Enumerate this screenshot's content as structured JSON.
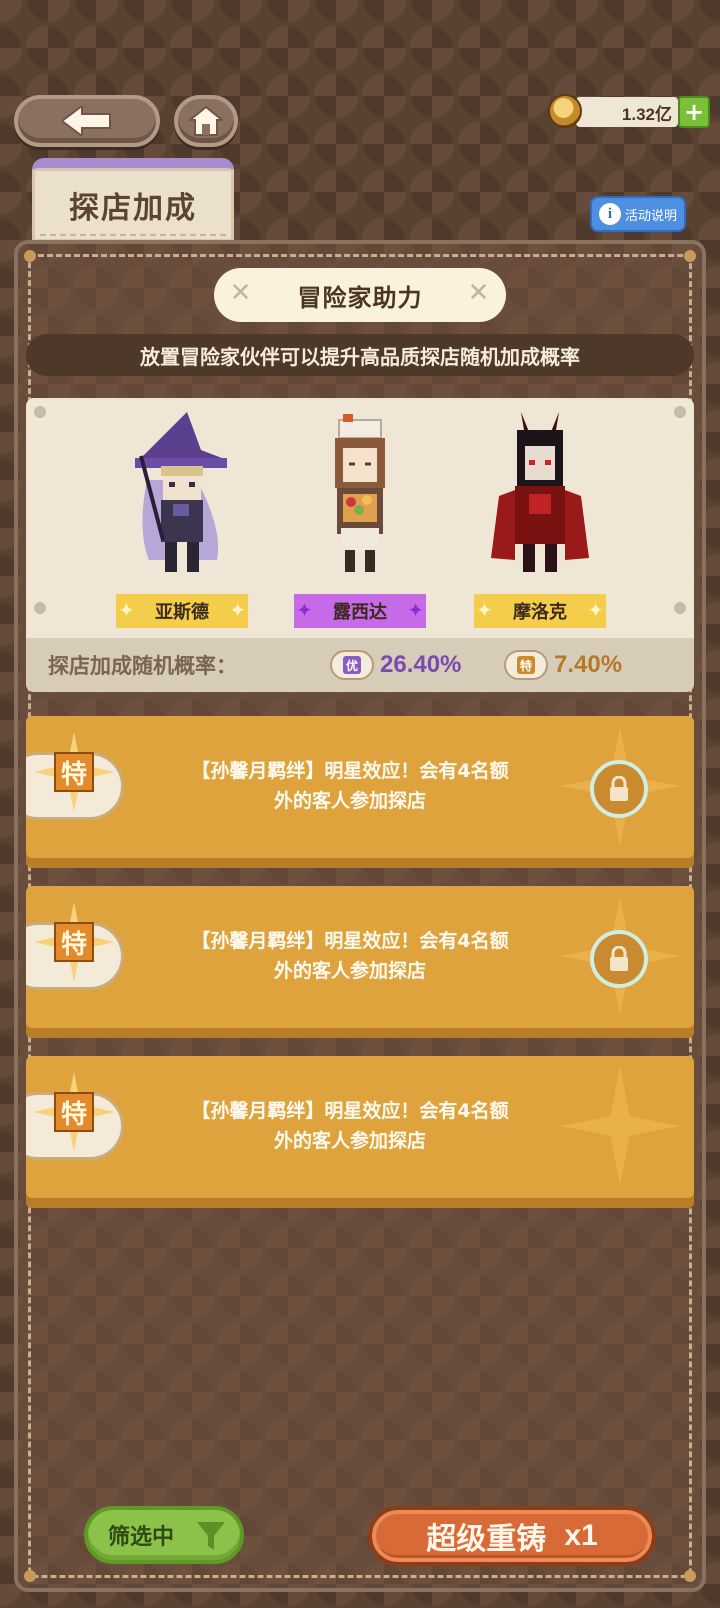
{
  "top_bar": {
    "back_icon": "arrow-left-icon",
    "home_icon": "home-icon",
    "currency": {
      "icon": "coin-icon",
      "amount": "1.32亿",
      "add_label": "+"
    }
  },
  "tab": {
    "label": "探店加成",
    "accent_color": "#a78ad0"
  },
  "info_button": {
    "label": "活动说明",
    "icon": "info-icon"
  },
  "panel": {
    "banner_title": "冒险家助力",
    "subtitle": "放置冒险家伙伴可以提升高品质探店随机加成概率",
    "heroes": [
      {
        "name": "亚斯德",
        "tag_color": "#f4cd4a"
      },
      {
        "name": "露西达",
        "tag_color": "#c66ae8"
      },
      {
        "name": "摩洛克",
        "tag_color": "#f4cd4a"
      }
    ],
    "rates": {
      "label": "探店加成随机概率：",
      "epic": {
        "tag": "优",
        "value": "26.40%"
      },
      "special": {
        "tag": "特",
        "value": "7.40%"
      }
    }
  },
  "bonus_cards": [
    {
      "tag": "特",
      "text": "【孙馨月羁绊】明星效应！会有4名额\n外的客人参加探店",
      "locked": true
    },
    {
      "tag": "特",
      "text": "【孙馨月羁绊】明星效应！会有4名额\n外的客人参加探店",
      "locked": true
    },
    {
      "tag": "特",
      "text": "【孙馨月羁绊】明星效应！会有4名额\n外的客人参加探店",
      "locked": false
    }
  ],
  "bottom": {
    "filter_label": "筛选中",
    "filter_icon": "funnel-icon",
    "recast_label": "超级重铸",
    "recast_count": "x1"
  }
}
